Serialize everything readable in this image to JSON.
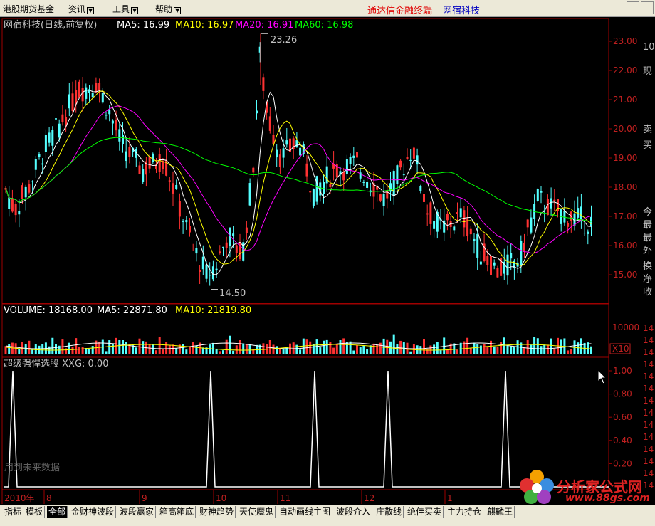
{
  "menu": {
    "items": [
      {
        "label": "港股期货基金",
        "dropdown": false
      },
      {
        "label": "资讯",
        "dropdown": true
      },
      {
        "label": "工具",
        "dropdown": true
      },
      {
        "label": "帮助",
        "dropdown": true
      }
    ],
    "brand": "通达信金融终端",
    "stock_name": "网宿科技"
  },
  "main_panel": {
    "header": "网宿科技(日线,前复权)",
    "ma": [
      {
        "label": "MA5: 16.99",
        "color": "#ffffff"
      },
      {
        "label": "MA10: 16.97",
        "color": "#ffff00"
      },
      {
        "label": "MA20: 16.91",
        "color": "#ff00ff"
      },
      {
        "label": "MA60: 16.98",
        "color": "#00ff00"
      }
    ],
    "high_label": "23.26",
    "low_label": "14.50",
    "y_ticks": [
      "23.00",
      "22.00",
      "21.00",
      "20.00",
      "19.00",
      "18.00",
      "17.00",
      "16.00",
      "15.00"
    ]
  },
  "volume_panel": {
    "header_parts": [
      {
        "label": "VOLUME: 18168.00",
        "color": "#ffffff"
      },
      {
        "label": "MA5: 22871.80",
        "color": "#ffffff"
      },
      {
        "label": "MA10: 21819.80",
        "color": "#ffff00"
      }
    ],
    "y_tick": "10000",
    "unit": "X10"
  },
  "indicator_panel": {
    "header": "超级强悍选股 XXG: 0.00",
    "y_ticks": [
      "1.00",
      "0.80",
      "0.60",
      "0.40",
      "0.20"
    ],
    "watermark_text": "用到未来数据"
  },
  "x_axis": {
    "labels": [
      "2010年",
      "8",
      "9",
      "10",
      "11",
      "12",
      "1"
    ]
  },
  "right_panel": {
    "chars": [
      "10",
      "现",
      "卖",
      "买",
      "今",
      "最",
      "最",
      "外",
      "换",
      "净",
      "收"
    ],
    "axis_marks": [
      "14",
      "14",
      "14",
      "14",
      "14",
      "14",
      "14",
      "14",
      "14",
      "14",
      "14",
      "14",
      "14",
      "14"
    ]
  },
  "tabs": [
    {
      "label": "指标",
      "active": false
    },
    {
      "label": "模板",
      "active": false
    },
    {
      "label": "全部",
      "active": true
    },
    {
      "label": "金财神波段",
      "active": false
    },
    {
      "label": "波段赢家",
      "active": false
    },
    {
      "label": "箱高箱底",
      "active": false
    },
    {
      "label": "财神趋势",
      "active": false
    },
    {
      "label": "天使魔鬼",
      "active": false
    },
    {
      "label": "自动画线主图",
      "active": false
    },
    {
      "label": "波段介入",
      "active": false
    },
    {
      "label": "庄散线",
      "active": false
    },
    {
      "label": "绝佳买卖",
      "active": false
    },
    {
      "label": "主力持仓",
      "active": false
    },
    {
      "label": "麒麟王",
      "active": false
    }
  ],
  "watermark": {
    "name": "分析家公式网",
    "url": "www.88gs.com"
  },
  "colors": {
    "up": "#ff3232",
    "down": "#54ffff",
    "frame": "#a00000"
  },
  "chart_data": {
    "type": "candlestick",
    "note_series": "price data not printed on screen; marks drawn procedurally",
    "high": 23.26,
    "low": 14.5
  }
}
